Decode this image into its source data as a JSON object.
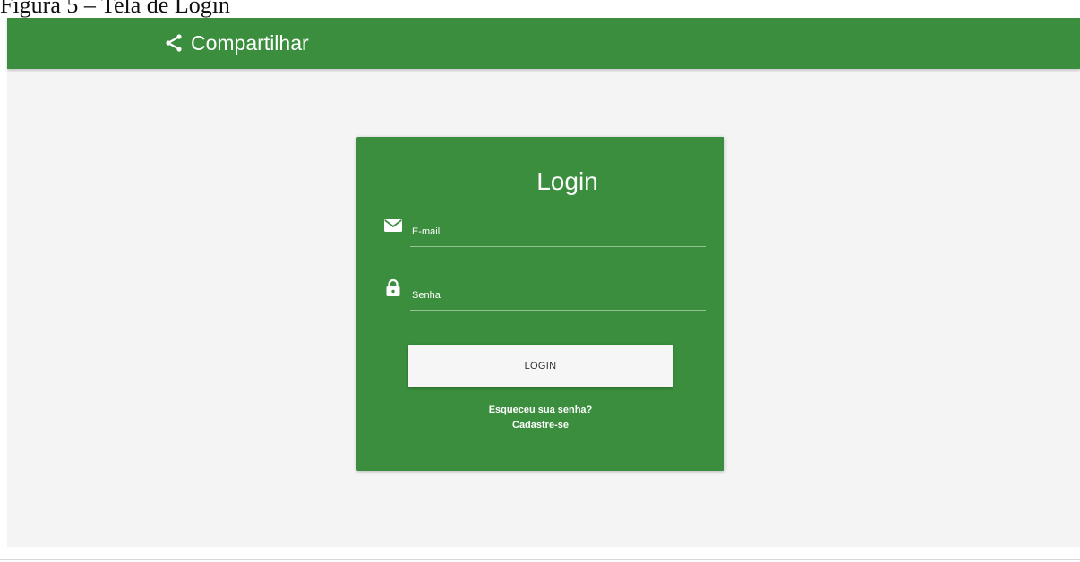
{
  "caption": "Figura 5 – Tela de Login",
  "appbar": {
    "share_icon": "share-icon",
    "share_label": "Compartilhar"
  },
  "login_card": {
    "title": "Login",
    "email": {
      "icon": "mail-icon",
      "placeholder": "E-mail",
      "value": ""
    },
    "password": {
      "icon": "lock-icon",
      "placeholder": "Senha",
      "value": ""
    },
    "login_button_label": "LOGIN",
    "forgot_password_link": "Esqueceu sua senha?",
    "signup_link": "Cadastre-se"
  },
  "colors": {
    "primary_green": "#3a8e3d",
    "page_background": "#f4f4f4",
    "button_background": "#f6f6f6",
    "text_on_primary": "#ffffff"
  }
}
